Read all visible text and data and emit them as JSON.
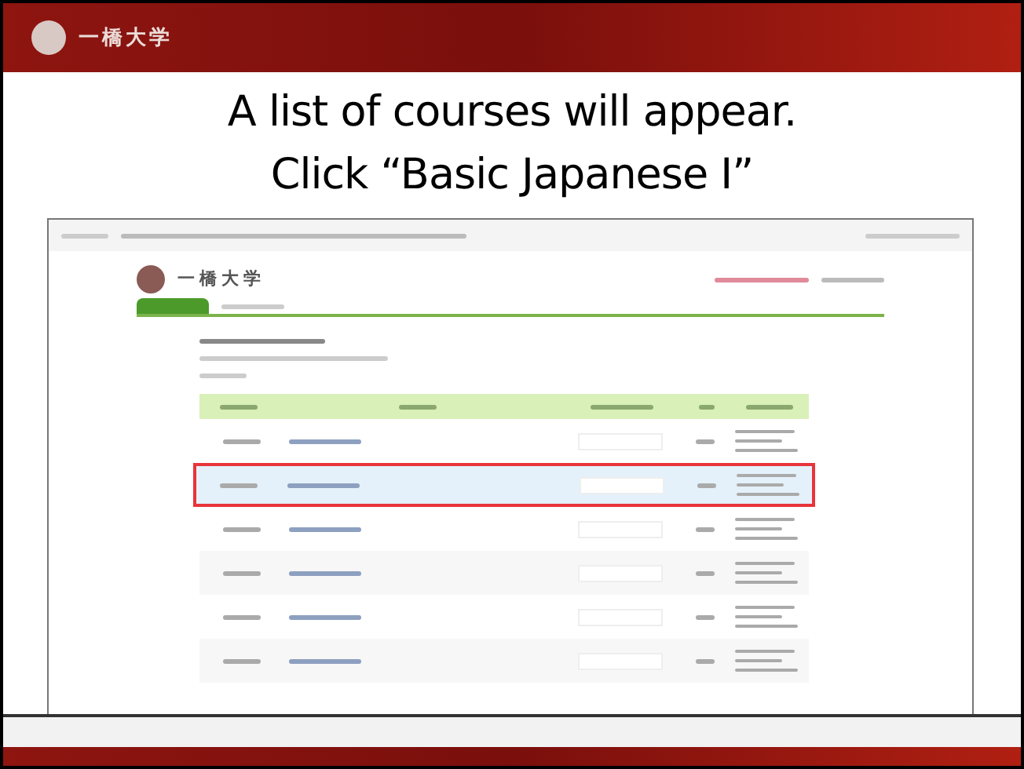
{
  "slide_header": {
    "logo_text": "一橋大学"
  },
  "title_lines": [
    "A list of courses will appear.",
    "Click “Basic Japanese I”"
  ],
  "screenshot": {
    "logo_text": "一 橋 大 学",
    "rows": [
      {
        "selected": false
      },
      {
        "selected": true
      },
      {
        "selected": false
      },
      {
        "selected": false
      },
      {
        "selected": false
      },
      {
        "selected": false
      }
    ]
  }
}
